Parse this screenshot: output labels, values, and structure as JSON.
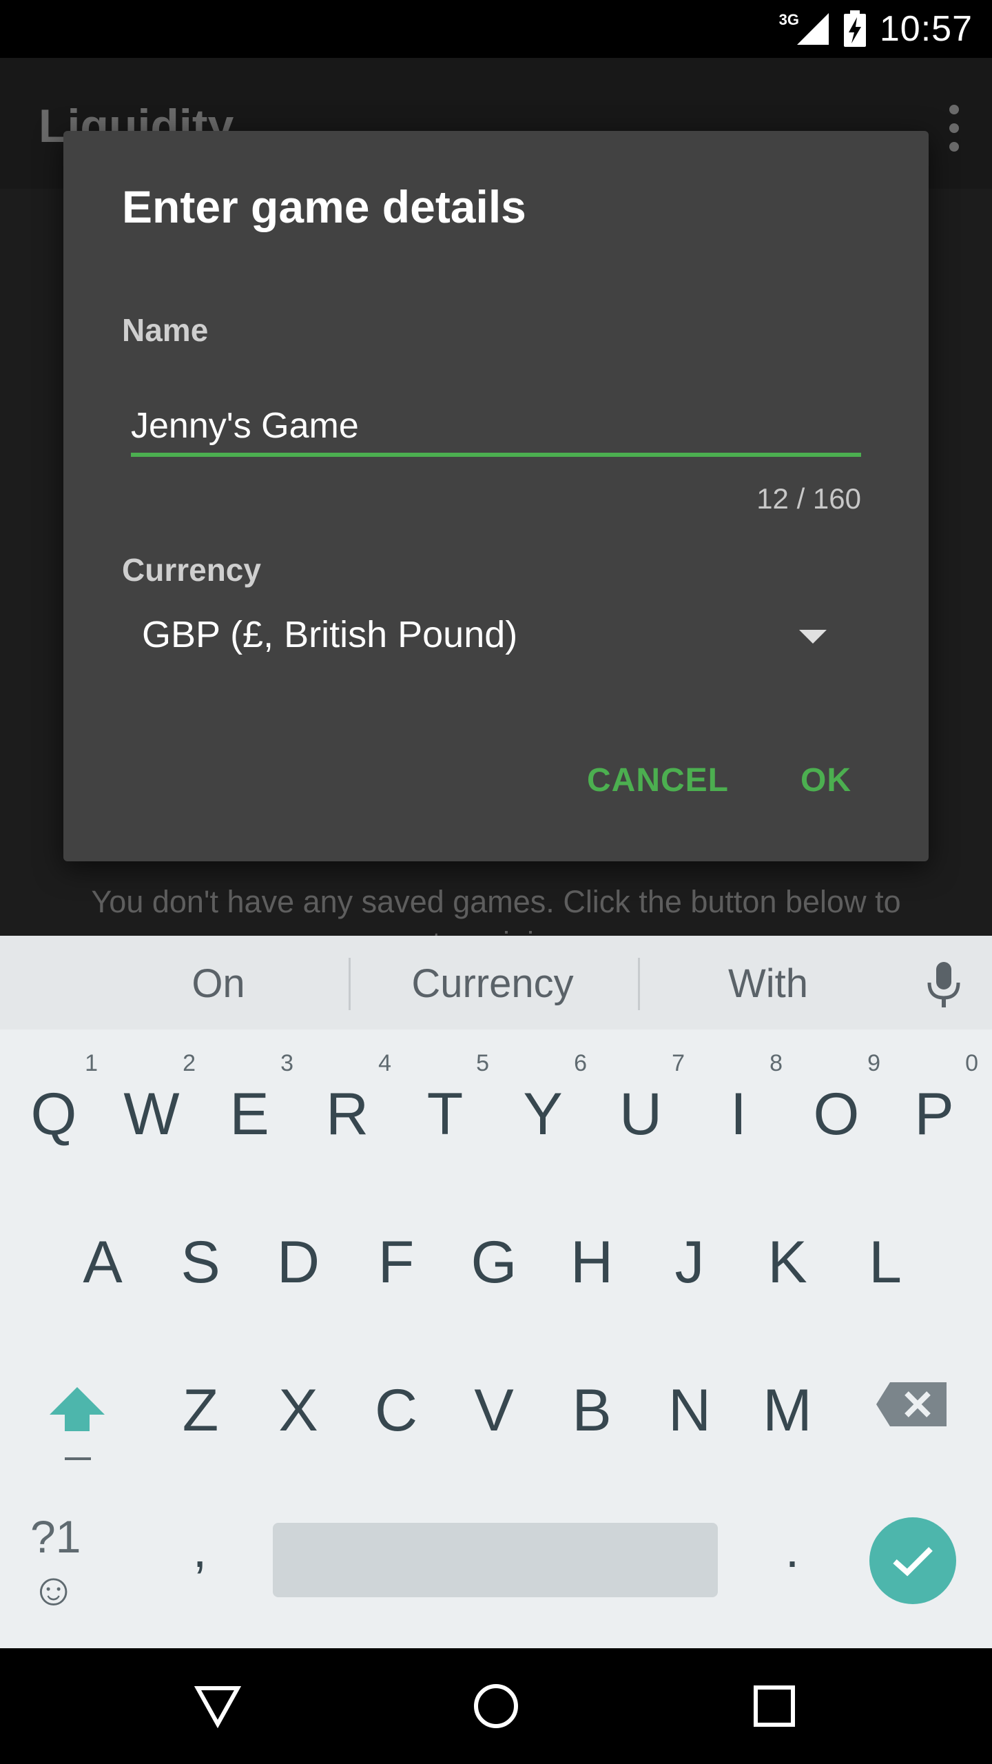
{
  "status_bar": {
    "network_type": "3G",
    "time": "10:57"
  },
  "app": {
    "title": "Liquidity",
    "empty_message_line1": "You don't have any saved games. Click the button below to",
    "empty_message_line2": "create or join one."
  },
  "dialog": {
    "title": "Enter game details",
    "name_label": "Name",
    "name_value": "Jenny's Game",
    "char_counter": "12 / 160",
    "currency_label": "Currency",
    "currency_value": "GBP (£, British Pound)",
    "cancel_label": "CANCEL",
    "ok_label": "OK",
    "accent_color": "#4caf50"
  },
  "keyboard": {
    "suggestions": [
      "On",
      "Currency",
      "With"
    ],
    "row1": [
      {
        "key": "Q",
        "hint": "1"
      },
      {
        "key": "W",
        "hint": "2"
      },
      {
        "key": "E",
        "hint": "3"
      },
      {
        "key": "R",
        "hint": "4"
      },
      {
        "key": "T",
        "hint": "5"
      },
      {
        "key": "Y",
        "hint": "6"
      },
      {
        "key": "U",
        "hint": "7"
      },
      {
        "key": "I",
        "hint": "8"
      },
      {
        "key": "O",
        "hint": "9"
      },
      {
        "key": "P",
        "hint": "0"
      }
    ],
    "row2": [
      "A",
      "S",
      "D",
      "F",
      "G",
      "H",
      "J",
      "K",
      "L"
    ],
    "row3": [
      "Z",
      "X",
      "C",
      "V",
      "B",
      "N",
      "M"
    ],
    "symbols_label": "?1☺",
    "comma": ",",
    "period": ".",
    "enter_color": "#4db6ac"
  }
}
